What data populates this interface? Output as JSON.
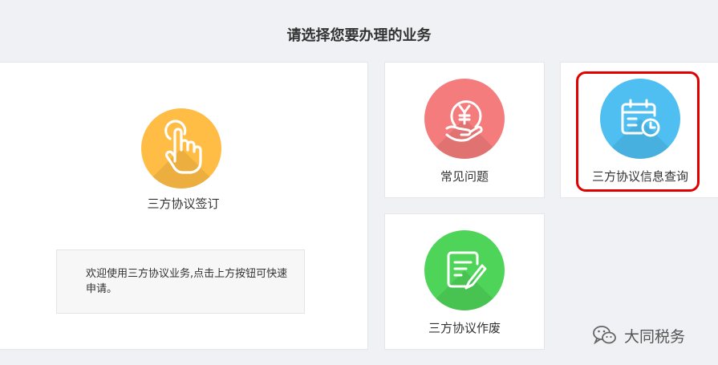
{
  "page": {
    "title": "请选择您要办理的业务"
  },
  "cards": {
    "sign": {
      "label": "三方协议签订",
      "icon": "tap-hand-icon",
      "color": "#ffbd45"
    },
    "faq": {
      "label": "常见问题",
      "icon": "yuan-coin-hand-icon",
      "color": "#f47c7c"
    },
    "query": {
      "label": "三方协议信息查询",
      "icon": "calendar-clock-icon",
      "color": "#4fbff2"
    },
    "void": {
      "label": "三方协议作废",
      "icon": "document-pen-icon",
      "color": "#4fd45a"
    }
  },
  "notice": {
    "text": "欢迎使用三方协议业务,点击上方按钮可快速申请。"
  },
  "highlight_color": "#e00000",
  "watermark": {
    "text": "大同税务",
    "icon": "wechat-icon"
  }
}
